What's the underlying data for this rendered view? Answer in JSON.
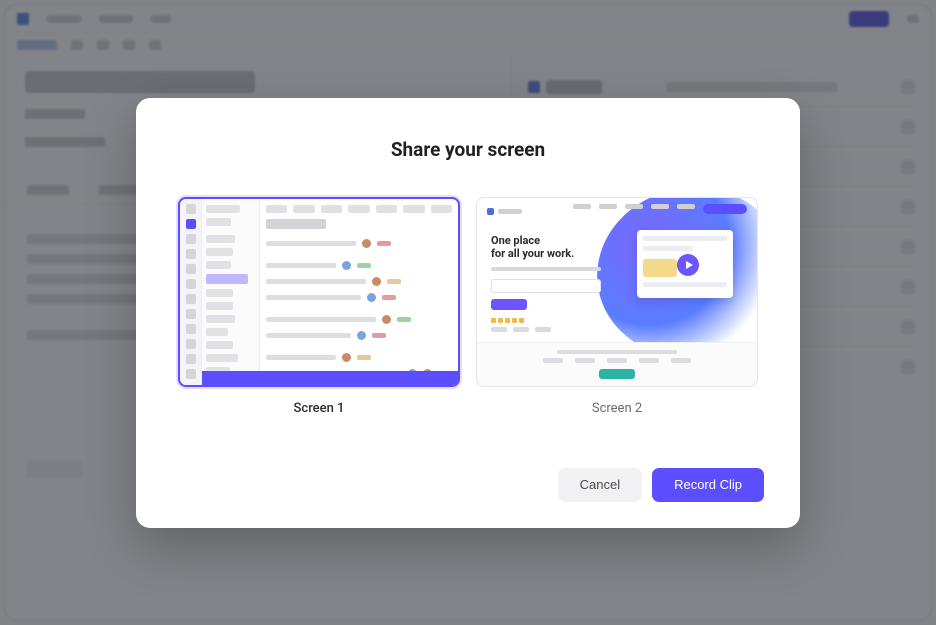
{
  "modal": {
    "title": "Share your screen",
    "cancel_label": "Cancel",
    "record_label": "Record Clip"
  },
  "screens": [
    {
      "label": "Screen 1",
      "selected": true
    },
    {
      "label": "Screen 2",
      "selected": false
    }
  ],
  "thumb2": {
    "headline_line1": "One place",
    "headline_line2": "for all your work."
  }
}
